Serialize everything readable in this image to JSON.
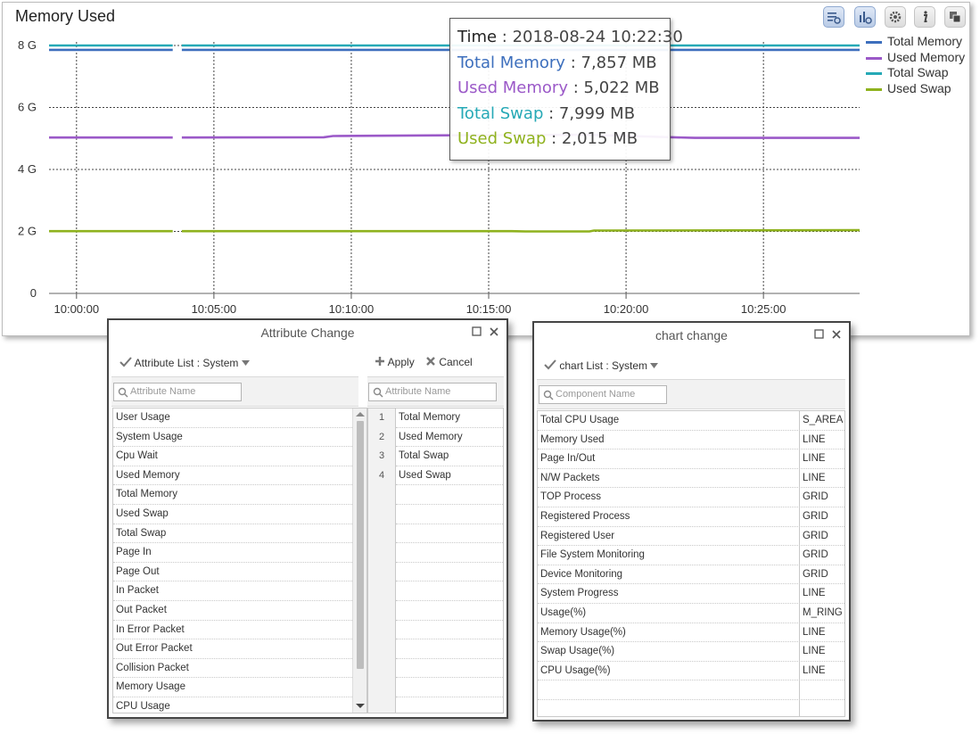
{
  "memory_chart": {
    "title": "Memory Used",
    "toolbar": [
      {
        "icon": "list-settings-icon",
        "active": true
      },
      {
        "icon": "chart-settings-icon",
        "active": true
      },
      {
        "icon": "gear-icon",
        "active": false
      },
      {
        "icon": "info-icon",
        "active": false
      },
      {
        "icon": "copy-window-icon",
        "active": false
      }
    ],
    "tooltip": {
      "time_label": "Time",
      "time_value": "2018-08-24 10:22:30",
      "rows": [
        {
          "label": "Total Memory",
          "value": "7,857 MB",
          "color": "#3d6fbd"
        },
        {
          "label": "Used Memory",
          "value": "5,022 MB",
          "color": "#9b59c8"
        },
        {
          "label": "Total Swap",
          "value": "7,999 MB",
          "color": "#26a9b6"
        },
        {
          "label": "Used Swap",
          "value": "2,015 MB",
          "color": "#8fb21e"
        }
      ]
    }
  },
  "chart_data": {
    "type": "line",
    "title": "Memory Used",
    "xlabel": "",
    "ylabel": "",
    "x_ticks": [
      "10:00:00",
      "10:05:00",
      "10:10:00",
      "10:15:00",
      "10:20:00",
      "10:25:00"
    ],
    "y_ticks": [
      "0",
      "2 G",
      "4 G",
      "6 G",
      "8 G"
    ],
    "ylim": [
      0,
      8
    ],
    "y_unit": "GB",
    "xlim": [
      "09:59:00",
      "10:28:30"
    ],
    "grid": true,
    "legend_position": "right",
    "series": [
      {
        "name": "Total Memory",
        "color": "#3d6fbd",
        "points": [
          [
            "09:59:00",
            7.86
          ],
          [
            "10:03:30",
            7.86
          ],
          [
            "10:03:50",
            7.86
          ],
          [
            "10:28:30",
            7.86
          ]
        ]
      },
      {
        "name": "Used Memory",
        "color": "#9b59c8",
        "points": [
          [
            "09:59:00",
            5.03
          ],
          [
            "10:03:30",
            5.03
          ],
          [
            "10:03:50",
            5.03
          ],
          [
            "10:09:00",
            5.04
          ],
          [
            "10:09:20",
            5.08
          ],
          [
            "10:13:00",
            5.1
          ],
          [
            "10:16:00",
            5.11
          ],
          [
            "10:18:30",
            5.12
          ],
          [
            "10:22:30",
            5.02
          ],
          [
            "10:23:00",
            5.02
          ],
          [
            "10:28:30",
            5.02
          ]
        ]
      },
      {
        "name": "Total Swap",
        "color": "#26a9b6",
        "points": [
          [
            "09:59:00",
            8.0
          ],
          [
            "10:03:30",
            8.0
          ],
          [
            "10:03:50",
            8.0
          ],
          [
            "10:28:30",
            8.0
          ]
        ]
      },
      {
        "name": "Used Swap",
        "color": "#8fb21e",
        "points": [
          [
            "09:59:00",
            2.01
          ],
          [
            "10:03:30",
            2.01
          ],
          [
            "10:03:50",
            2.01
          ],
          [
            "10:15:50",
            2.01
          ],
          [
            "10:16:20",
            2.0
          ],
          [
            "10:18:40",
            2.0
          ],
          [
            "10:18:50",
            2.03
          ],
          [
            "10:28:30",
            2.04
          ]
        ]
      }
    ]
  },
  "attribute_dialog": {
    "title": "Attribute Change",
    "list_selector": "Attribute List : System",
    "apply_label": "Apply",
    "cancel_label": "Cancel",
    "left_search_placeholder": "Attribute Name",
    "right_search_placeholder": "Attribute Name",
    "available_attributes": [
      "User Usage",
      "System Usage",
      "Cpu Wait",
      "Used Memory",
      "Total Memory",
      "Used Swap",
      "Total Swap",
      "Page In",
      "Page Out",
      "In Packet",
      "Out Packet",
      "In Error Packet",
      "Out Error Packet",
      "Collision Packet",
      "Memory Usage",
      "CPU Usage"
    ],
    "selected_attributes": [
      {
        "num": "1",
        "name": "Total Memory"
      },
      {
        "num": "2",
        "name": "Used Memory"
      },
      {
        "num": "3",
        "name": "Total Swap"
      },
      {
        "num": "4",
        "name": "Used Swap"
      }
    ]
  },
  "chart_dialog": {
    "title": "chart change",
    "list_selector": "chart List : System",
    "search_placeholder": "Component Name",
    "components": [
      {
        "name": "Total CPU Usage",
        "type": "S_AREA"
      },
      {
        "name": "Memory Used",
        "type": "LINE"
      },
      {
        "name": "Page In/Out",
        "type": "LINE"
      },
      {
        "name": "N/W Packets",
        "type": "LINE"
      },
      {
        "name": "TOP Process",
        "type": "GRID"
      },
      {
        "name": "Registered Process",
        "type": "GRID"
      },
      {
        "name": "Registered User",
        "type": "GRID"
      },
      {
        "name": "File System Monitoring",
        "type": "GRID"
      },
      {
        "name": "Device Monitoring",
        "type": "GRID"
      },
      {
        "name": "System Progress",
        "type": "LINE"
      },
      {
        "name": "Usage(%)",
        "type": "M_RING"
      },
      {
        "name": "Memory Usage(%)",
        "type": "LINE"
      },
      {
        "name": "Swap Usage(%)",
        "type": "LINE"
      },
      {
        "name": "CPU Usage(%)",
        "type": "LINE"
      }
    ]
  }
}
